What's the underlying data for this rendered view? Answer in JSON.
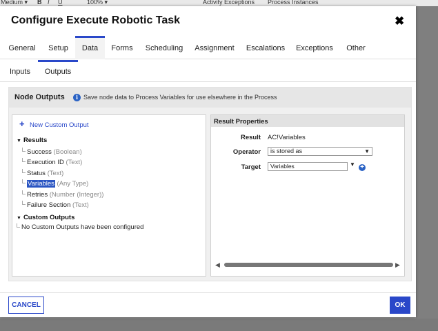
{
  "background": {
    "toolbar": {
      "font_size": "Medium ▾",
      "bold": "B",
      "italic": "I",
      "underline": "U",
      "zoom": "100% ▾",
      "activity_exceptions": "Activity Exceptions",
      "process_instances": "Process Instances"
    }
  },
  "dialog": {
    "title": "Configure Execute Robotic Task",
    "close_glyph": "✖",
    "tabs": [
      "General",
      "Setup",
      "Data",
      "Forms",
      "Scheduling",
      "Assignment",
      "Escalations",
      "Exceptions",
      "Other"
    ],
    "active_tab": "Data",
    "subtabs": [
      "Inputs",
      "Outputs"
    ],
    "active_subtab": "Outputs",
    "node_outputs": {
      "title": "Node Outputs",
      "description": "Save node data to Process Variables for use elsewhere in the Process"
    },
    "tree": {
      "new_custom_output": "New Custom Output",
      "results_label": "Results",
      "results": [
        {
          "name": "Success",
          "type": "(Boolean)"
        },
        {
          "name": "Execution ID",
          "type": "(Text)"
        },
        {
          "name": "Status",
          "type": "(Text)"
        },
        {
          "name": "Variables",
          "type": "(Any Type)",
          "selected": true
        },
        {
          "name": "Retries",
          "type": "(Number (Integer))"
        },
        {
          "name": "Failure Section",
          "type": "(Text)"
        }
      ],
      "custom_outputs_label": "Custom Outputs",
      "custom_outputs_empty": "No Custom Outputs have been configured"
    },
    "result_properties": {
      "header": "Result Properties",
      "result_label": "Result",
      "result_value": "AC!Variables",
      "operator_label": "Operator",
      "operator_value": "is stored as",
      "target_label": "Target",
      "target_value": "Variables"
    },
    "buttons": {
      "cancel": "CANCEL",
      "ok": "OK"
    }
  },
  "colors": {
    "accent": "#2a48c9",
    "selection": "#2a55c2",
    "panel_bg": "#f0f0f0"
  }
}
